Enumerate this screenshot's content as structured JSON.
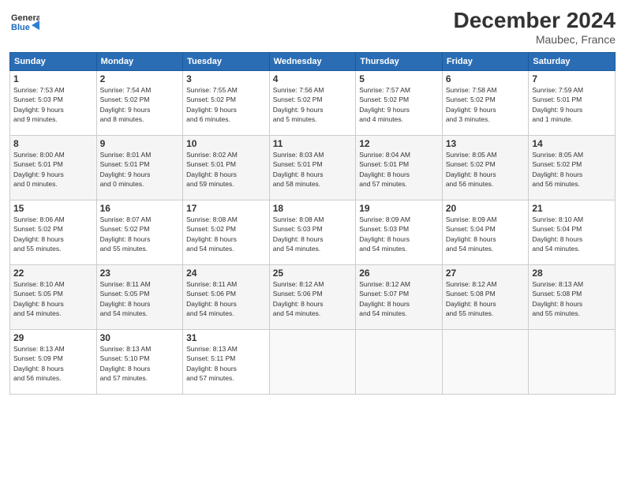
{
  "header": {
    "logo_line1": "General",
    "logo_line2": "Blue",
    "month": "December 2024",
    "location": "Maubec, France"
  },
  "weekdays": [
    "Sunday",
    "Monday",
    "Tuesday",
    "Wednesday",
    "Thursday",
    "Friday",
    "Saturday"
  ],
  "weeks": [
    [
      {
        "day": "1",
        "info": "Sunrise: 7:53 AM\nSunset: 5:03 PM\nDaylight: 9 hours\nand 9 minutes."
      },
      {
        "day": "2",
        "info": "Sunrise: 7:54 AM\nSunset: 5:02 PM\nDaylight: 9 hours\nand 8 minutes."
      },
      {
        "day": "3",
        "info": "Sunrise: 7:55 AM\nSunset: 5:02 PM\nDaylight: 9 hours\nand 6 minutes."
      },
      {
        "day": "4",
        "info": "Sunrise: 7:56 AM\nSunset: 5:02 PM\nDaylight: 9 hours\nand 5 minutes."
      },
      {
        "day": "5",
        "info": "Sunrise: 7:57 AM\nSunset: 5:02 PM\nDaylight: 9 hours\nand 4 minutes."
      },
      {
        "day": "6",
        "info": "Sunrise: 7:58 AM\nSunset: 5:02 PM\nDaylight: 9 hours\nand 3 minutes."
      },
      {
        "day": "7",
        "info": "Sunrise: 7:59 AM\nSunset: 5:01 PM\nDaylight: 9 hours\nand 1 minute."
      }
    ],
    [
      {
        "day": "8",
        "info": "Sunrise: 8:00 AM\nSunset: 5:01 PM\nDaylight: 9 hours\nand 0 minutes."
      },
      {
        "day": "9",
        "info": "Sunrise: 8:01 AM\nSunset: 5:01 PM\nDaylight: 9 hours\nand 0 minutes."
      },
      {
        "day": "10",
        "info": "Sunrise: 8:02 AM\nSunset: 5:01 PM\nDaylight: 8 hours\nand 59 minutes."
      },
      {
        "day": "11",
        "info": "Sunrise: 8:03 AM\nSunset: 5:01 PM\nDaylight: 8 hours\nand 58 minutes."
      },
      {
        "day": "12",
        "info": "Sunrise: 8:04 AM\nSunset: 5:01 PM\nDaylight: 8 hours\nand 57 minutes."
      },
      {
        "day": "13",
        "info": "Sunrise: 8:05 AM\nSunset: 5:02 PM\nDaylight: 8 hours\nand 56 minutes."
      },
      {
        "day": "14",
        "info": "Sunrise: 8:05 AM\nSunset: 5:02 PM\nDaylight: 8 hours\nand 56 minutes."
      }
    ],
    [
      {
        "day": "15",
        "info": "Sunrise: 8:06 AM\nSunset: 5:02 PM\nDaylight: 8 hours\nand 55 minutes."
      },
      {
        "day": "16",
        "info": "Sunrise: 8:07 AM\nSunset: 5:02 PM\nDaylight: 8 hours\nand 55 minutes."
      },
      {
        "day": "17",
        "info": "Sunrise: 8:08 AM\nSunset: 5:02 PM\nDaylight: 8 hours\nand 54 minutes."
      },
      {
        "day": "18",
        "info": "Sunrise: 8:08 AM\nSunset: 5:03 PM\nDaylight: 8 hours\nand 54 minutes."
      },
      {
        "day": "19",
        "info": "Sunrise: 8:09 AM\nSunset: 5:03 PM\nDaylight: 8 hours\nand 54 minutes."
      },
      {
        "day": "20",
        "info": "Sunrise: 8:09 AM\nSunset: 5:04 PM\nDaylight: 8 hours\nand 54 minutes."
      },
      {
        "day": "21",
        "info": "Sunrise: 8:10 AM\nSunset: 5:04 PM\nDaylight: 8 hours\nand 54 minutes."
      }
    ],
    [
      {
        "day": "22",
        "info": "Sunrise: 8:10 AM\nSunset: 5:05 PM\nDaylight: 8 hours\nand 54 minutes."
      },
      {
        "day": "23",
        "info": "Sunrise: 8:11 AM\nSunset: 5:05 PM\nDaylight: 8 hours\nand 54 minutes."
      },
      {
        "day": "24",
        "info": "Sunrise: 8:11 AM\nSunset: 5:06 PM\nDaylight: 8 hours\nand 54 minutes."
      },
      {
        "day": "25",
        "info": "Sunrise: 8:12 AM\nSunset: 5:06 PM\nDaylight: 8 hours\nand 54 minutes."
      },
      {
        "day": "26",
        "info": "Sunrise: 8:12 AM\nSunset: 5:07 PM\nDaylight: 8 hours\nand 54 minutes."
      },
      {
        "day": "27",
        "info": "Sunrise: 8:12 AM\nSunset: 5:08 PM\nDaylight: 8 hours\nand 55 minutes."
      },
      {
        "day": "28",
        "info": "Sunrise: 8:13 AM\nSunset: 5:08 PM\nDaylight: 8 hours\nand 55 minutes."
      }
    ],
    [
      {
        "day": "29",
        "info": "Sunrise: 8:13 AM\nSunset: 5:09 PM\nDaylight: 8 hours\nand 56 minutes."
      },
      {
        "day": "30",
        "info": "Sunrise: 8:13 AM\nSunset: 5:10 PM\nDaylight: 8 hours\nand 57 minutes."
      },
      {
        "day": "31",
        "info": "Sunrise: 8:13 AM\nSunset: 5:11 PM\nDaylight: 8 hours\nand 57 minutes."
      },
      null,
      null,
      null,
      null
    ]
  ]
}
